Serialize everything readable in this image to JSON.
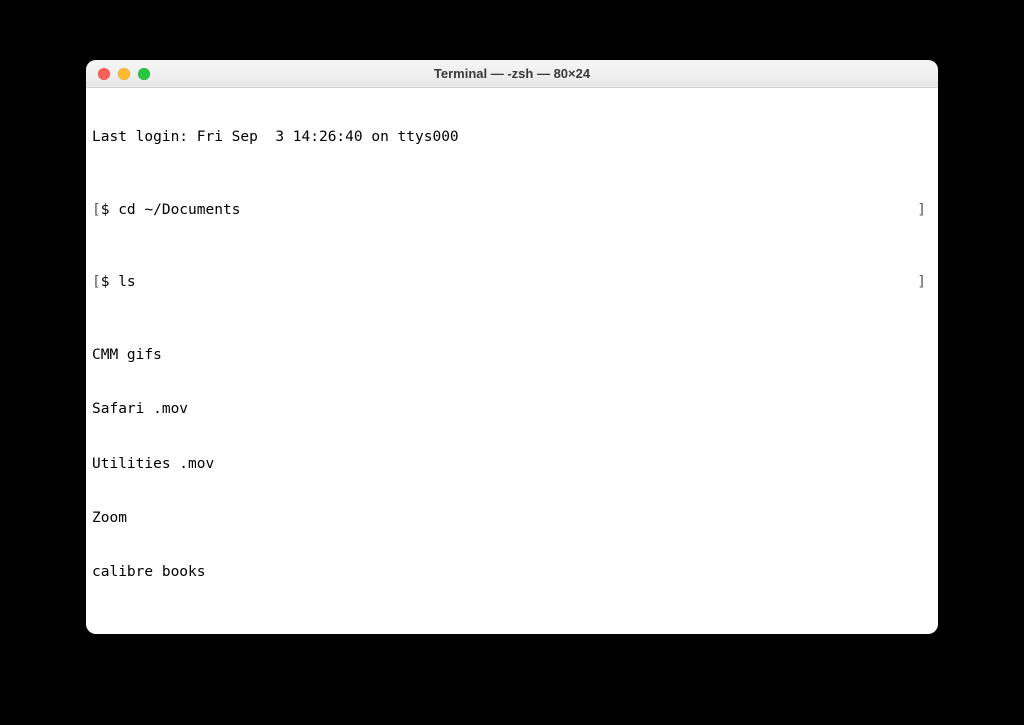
{
  "window": {
    "title": "Terminal — -zsh — 80×24"
  },
  "terminal": {
    "banner": "Last login: Fri Sep  3 14:26:40 on ttys000",
    "lines": [
      {
        "prompt": "$ ",
        "text": "cd ~/Documents",
        "left_br": "[",
        "right_br": "]"
      },
      {
        "prompt": "$ ",
        "text": "ls",
        "left_br": "[",
        "right_br": "]"
      }
    ],
    "output": [
      "CMM gifs",
      "Safari .mov",
      "Utilities .mov",
      "Zoom",
      "calibre books"
    ],
    "active_prompt": {
      "prompt": "$ ",
      "left_br": "["
    }
  }
}
